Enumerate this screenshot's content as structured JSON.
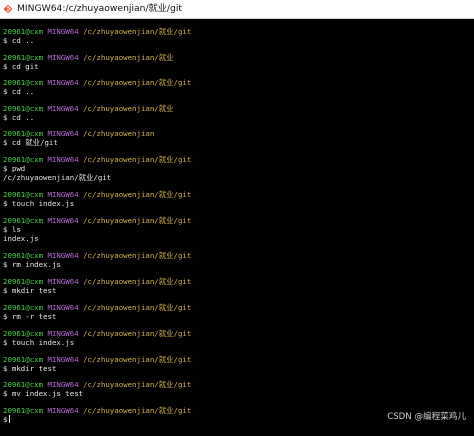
{
  "window": {
    "title": "MINGW64:/c/zhuyaowenjian/就业/git"
  },
  "prompt": {
    "user": "20961@cxm",
    "host": "MINGW64"
  },
  "terminal": {
    "blocks": [
      {
        "path": "/c/zhuyaowenjian/就业/git",
        "command": "$ cd ..",
        "output": ""
      },
      {
        "path": "/c/zhuyaowenjian/就业",
        "command": "$ cd git",
        "output": ""
      },
      {
        "path": "/c/zhuyaowenjian/就业/git",
        "command": "$ cd ..",
        "output": ""
      },
      {
        "path": "/c/zhuyaowenjian/就业",
        "command": "$ cd ..",
        "output": ""
      },
      {
        "path": "/c/zhuyaowenjian",
        "command": "$ cd 就业/git",
        "output": ""
      },
      {
        "path": "/c/zhuyaowenjian/就业/git",
        "command": "$ pwd",
        "output": "/c/zhuyaowenjian/就业/git"
      },
      {
        "path": "/c/zhuyaowenjian/就业/git",
        "command": "$ touch index.js",
        "output": ""
      },
      {
        "path": "/c/zhuyaowenjian/就业/git",
        "command": "$ ls",
        "output": "index.js"
      },
      {
        "path": "/c/zhuyaowenjian/就业/git",
        "command": "$ rm index.js",
        "output": ""
      },
      {
        "path": "/c/zhuyaowenjian/就业/git",
        "command": "$ mkdir test",
        "output": ""
      },
      {
        "path": "/c/zhuyaowenjian/就业/git",
        "command": "$ rm -r test",
        "output": ""
      },
      {
        "path": "/c/zhuyaowenjian/就业/git",
        "command": "$ touch index.js",
        "output": ""
      },
      {
        "path": "/c/zhuyaowenjian/就业/git",
        "command": "$ mkdir test",
        "output": ""
      },
      {
        "path": "/c/zhuyaowenjian/就业/git",
        "command": "$ mv index.js test",
        "output": ""
      },
      {
        "path": "/c/zhuyaowenjian/就业/git",
        "command": "$",
        "output": ""
      }
    ]
  },
  "watermark": "CSDN @编程菜鸡儿",
  "icons": {
    "app": "git-bash-icon"
  },
  "colors": {
    "background": "#000000",
    "text": "#e6e6e6",
    "user": "#4fd14f",
    "host": "#b86ad6",
    "path": "#d2b44c"
  }
}
